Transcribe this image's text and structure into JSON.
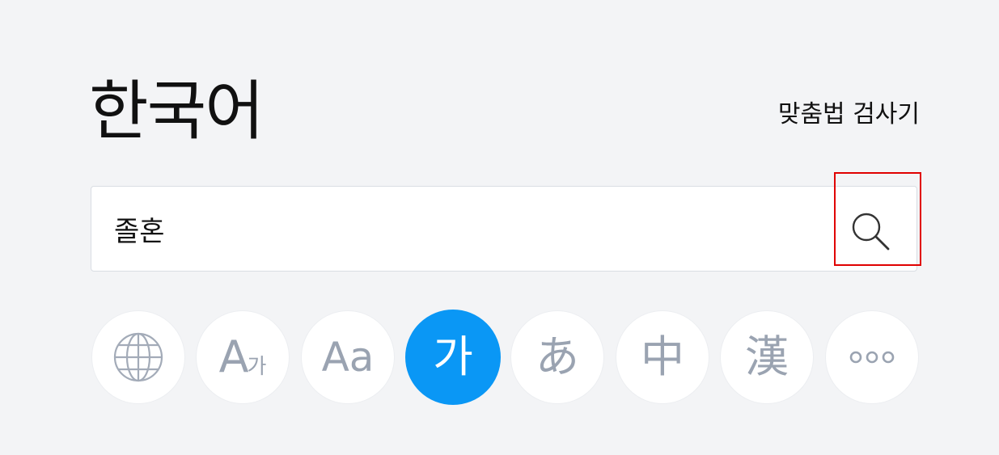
{
  "header": {
    "title": "한국어",
    "spell_checker_link": "맞춤법 검사기"
  },
  "search": {
    "query": "졸혼",
    "placeholder": ""
  },
  "language_buttons": [
    {
      "name": "globe-icon",
      "label": ""
    },
    {
      "name": "romanization",
      "label": "A",
      "sub": "가"
    },
    {
      "name": "english",
      "label": "Aa"
    },
    {
      "name": "korean",
      "label": "가",
      "selected": true
    },
    {
      "name": "japanese",
      "label": "あ"
    },
    {
      "name": "chinese",
      "label": "中"
    },
    {
      "name": "hanja",
      "label": "漢"
    },
    {
      "name": "more-icon",
      "label": ""
    }
  ],
  "colors": {
    "background": "#f3f4f6",
    "accent": "#0a97f5",
    "icon_gray": "#9aa3b1",
    "highlight_box": "#e00000"
  }
}
